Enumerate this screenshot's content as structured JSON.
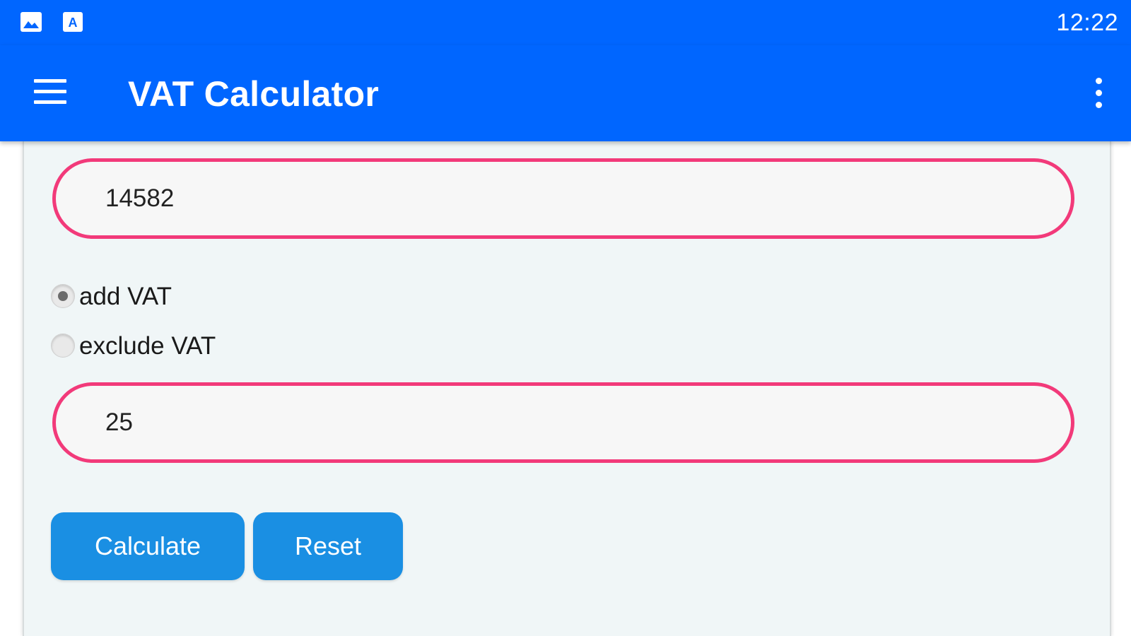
{
  "status_bar": {
    "icons": [
      "image-icon",
      "text-a-icon"
    ],
    "time": "12:22",
    "background_color": "#0066ff"
  },
  "app_bar": {
    "title": "VAT Calculator",
    "menu_icon": "hamburger-menu-icon",
    "overflow_icon": "more-vertical-icon",
    "background_color": "#0066ff"
  },
  "form": {
    "amount_value": "14582",
    "vat_mode": {
      "selected": "add VAT",
      "options": [
        "add VAT",
        "exclude VAT"
      ]
    },
    "rate_value": "25",
    "input_border_color": "#f23a7a"
  },
  "buttons": {
    "calculate_label": "Calculate",
    "reset_label": "Reset",
    "color": "#1a8fe3"
  }
}
